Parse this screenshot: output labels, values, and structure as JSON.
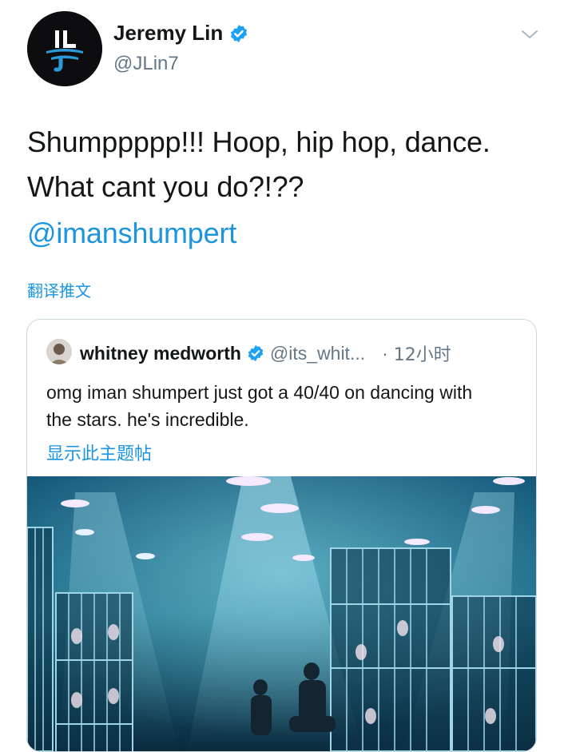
{
  "tweet": {
    "author_name": "Jeremy Lin",
    "author_handle": "@JLin7",
    "text_line1": "Shumppppp!!! Hoop, hip hop, dance.",
    "text_line2": "What cant you do?!??",
    "mention": "@imanshumpert",
    "translate_label": "翻译推文"
  },
  "quoted_tweet": {
    "author_name": "whitney medworth",
    "author_handle": "@its_whit...",
    "separator": "·",
    "time": "12小时",
    "text": "omg iman shumpert just got a 40/40 on dancing with the stars. he's incredible.",
    "show_thread_label": "显示此主题帖"
  },
  "icons": {
    "verified": "verified-badge-icon",
    "caret": "chevron-down-icon"
  },
  "colors": {
    "link": "#1b95e0",
    "secondary_text": "#657786",
    "verified": "#1da1f2"
  }
}
